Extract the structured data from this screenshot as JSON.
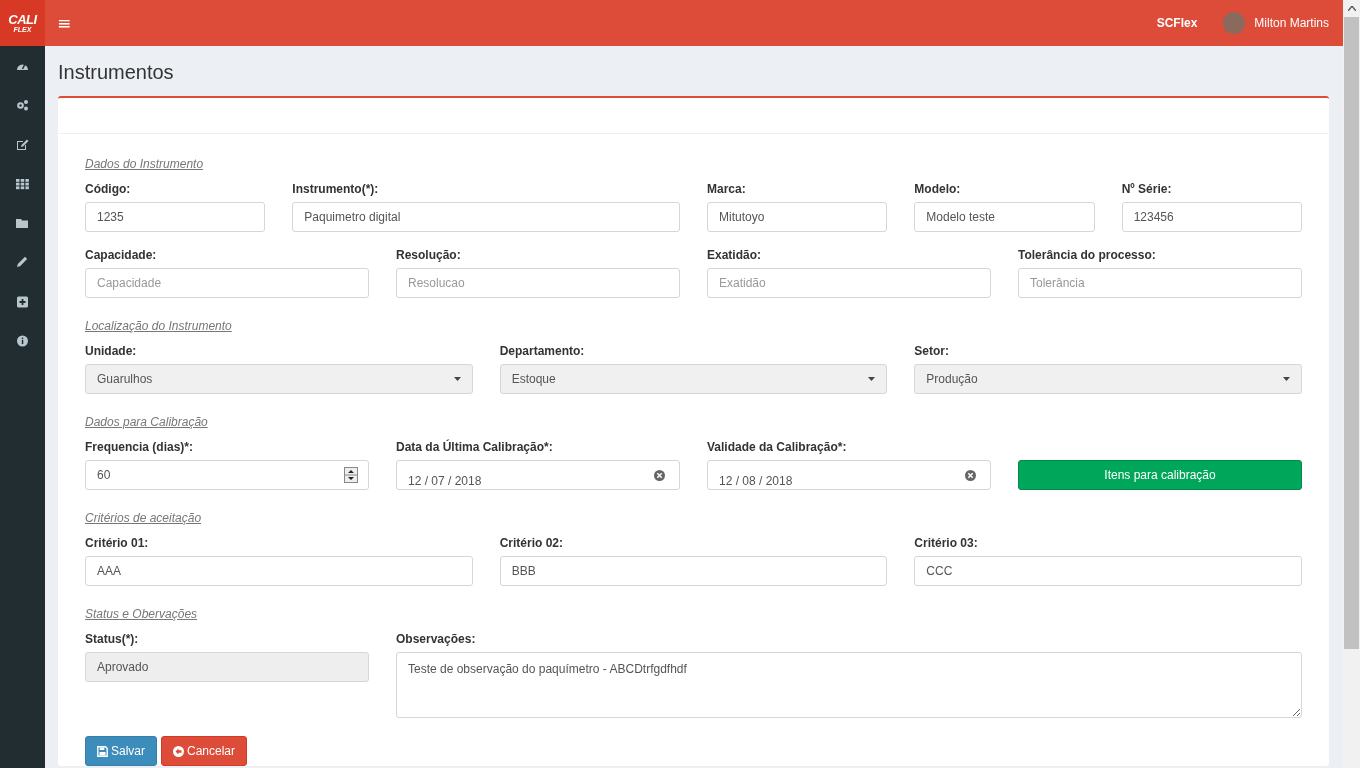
{
  "header": {
    "logo_top": "CALI",
    "logo_bottom": "FLEX",
    "menu_icon": "≡",
    "app_name": "SCFlex",
    "user_name": "Milton Martins"
  },
  "page": {
    "title": "Instrumentos"
  },
  "sections": [
    {
      "title": "Dados do Instrumento",
      "fields": [
        {
          "kind": "text",
          "label": "Código:",
          "value": "1235"
        },
        {
          "kind": "text",
          "label": "Instrumento(*):",
          "value": "Paquimetro digital"
        },
        {
          "kind": "text",
          "label": "Marca:",
          "value": "Mitutoyo"
        },
        {
          "kind": "text",
          "label": "Modelo:",
          "value": "Modelo teste"
        },
        {
          "kind": "text",
          "label": "Nº Série:",
          "value": "123456"
        },
        {
          "kind": "text",
          "label": "Capacidade:",
          "placeholder": "Capacidade"
        },
        {
          "kind": "text",
          "label": "Resolução:",
          "placeholder": "Resolucao"
        },
        {
          "kind": "text",
          "label": "Exatidão:",
          "placeholder": "Exatidão"
        },
        {
          "kind": "text",
          "label": "Tolerância do processo:",
          "placeholder": "Tolerância"
        }
      ]
    },
    {
      "title": "Localização do Instrumento",
      "fields": [
        {
          "kind": "select",
          "label": "Unidade:",
          "value": "Guarulhos"
        },
        {
          "kind": "select",
          "label": "Departamento:",
          "value": "Estoque"
        },
        {
          "kind": "select",
          "label": "Setor:",
          "value": "Produção"
        }
      ]
    },
    {
      "title": "Dados para Calibração",
      "fields": [
        {
          "kind": "number",
          "label": "Frequencia (dias)*:",
          "value": "60"
        },
        {
          "kind": "date",
          "label": "Data da Última Calibração*:",
          "value": "12 / 07 / 2018"
        },
        {
          "kind": "date",
          "label": "Validade da Calibração*:",
          "value": "12 / 08 / 2018"
        },
        {
          "kind": "button",
          "value": "Itens para calibração"
        }
      ]
    },
    {
      "title": "Critérios de aceitação",
      "fields": [
        {
          "kind": "text",
          "label": "Critério 01:",
          "value": "AAA"
        },
        {
          "kind": "text",
          "label": "Critério 02:",
          "value": "BBB"
        },
        {
          "kind": "text",
          "label": "Critério 03:",
          "value": "CCC"
        }
      ]
    },
    {
      "title": "Status e Obervações",
      "fields": [
        {
          "kind": "readonly",
          "label": "Status(*):",
          "value": "Aprovado"
        },
        {
          "kind": "textarea",
          "label": "Observações:",
          "value": "Teste de observação do paquímetro - ABCDtrfgdfhdf"
        }
      ]
    }
  ],
  "actions": [
    {
      "kind": "save",
      "label": "Salvar"
    },
    {
      "kind": "cancel",
      "label": "Cancelar"
    }
  ]
}
